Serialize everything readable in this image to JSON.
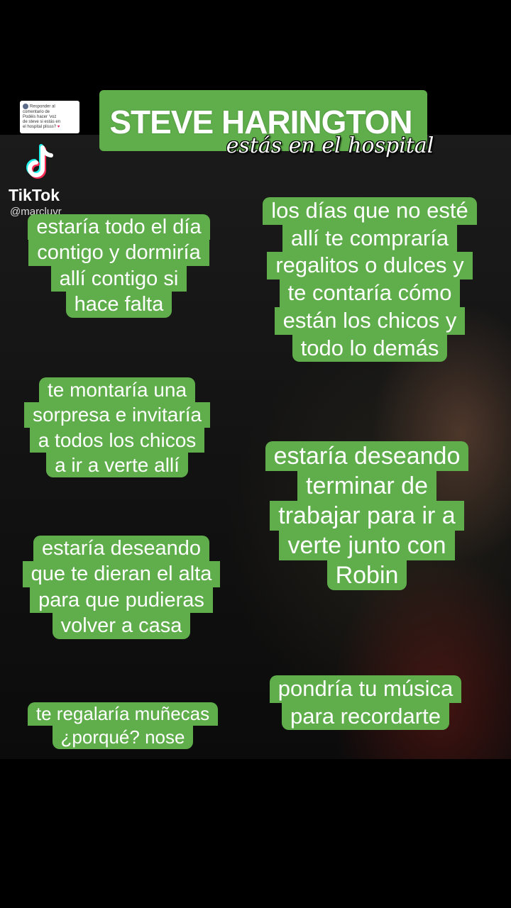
{
  "header": {
    "title": "STEVE HARINGTON",
    "subtitle": "estás en el hospital"
  },
  "comment_reply": {
    "line1": "Responder al comentario de",
    "line2": "Podéis hacer ‘voz",
    "line3": "de steve si estás en",
    "line4": "el hospital plisss?"
  },
  "watermark": {
    "brand": "TikTok",
    "handle": "@marcluvr",
    "colors": {
      "cyan": "#25f4ee",
      "red": "#fe2c55"
    }
  },
  "bubbles": {
    "b1": [
      "estaría todo el día",
      "contigo y dormiría",
      "allí contigo si",
      "hace falta"
    ],
    "b2": [
      "los días que no esté",
      "allí te compraría",
      "regalitos o dulces y",
      "te contaría cómo",
      "están los chicos y",
      "todo lo demás"
    ],
    "b3": [
      "te montaría una",
      "sorpresa e invitaría",
      "a todos los chicos",
      "a ir a verte allí"
    ],
    "b4": [
      "estaría deseando",
      "terminar de",
      "trabajar para ir a",
      "verte junto con",
      "Robin"
    ],
    "b5": [
      "estaría deseando",
      "que te dieran el alta",
      "para que pudieras",
      "volver a casa"
    ],
    "b6": [
      "pondría tu música",
      "para recordarte"
    ],
    "b7": [
      "te regalaría muñecas",
      "¿porqué? nose"
    ]
  },
  "colors": {
    "bubble_green": "#5fae4b",
    "background": "#000000"
  }
}
